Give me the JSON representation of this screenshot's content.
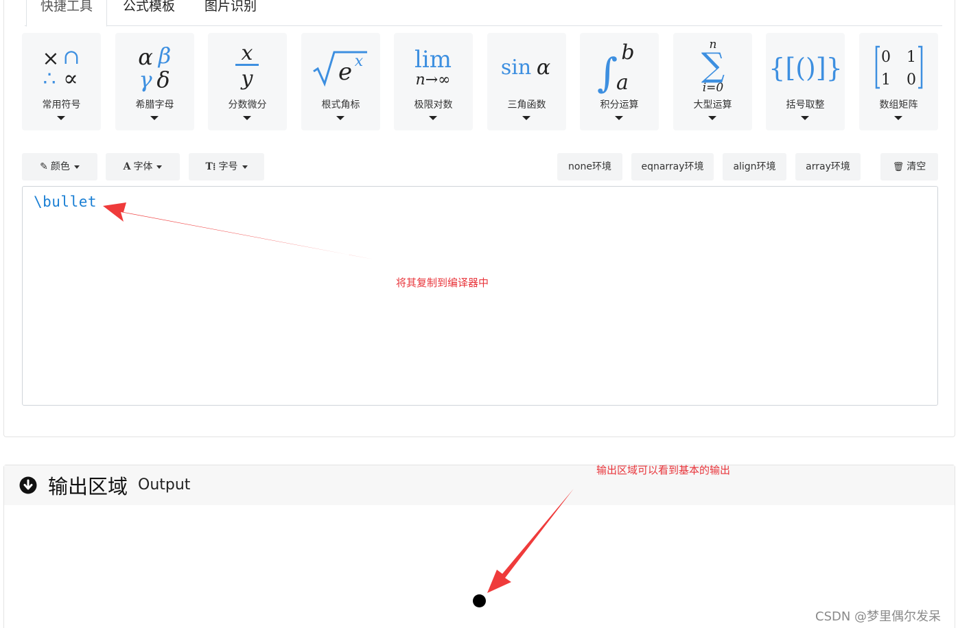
{
  "tabs": [
    {
      "label": "快捷工具",
      "active": true
    },
    {
      "label": "公式模板",
      "active": false
    },
    {
      "label": "图片识别",
      "active": false
    }
  ],
  "tools": [
    {
      "label": "常用符号"
    },
    {
      "label": "希腊字母"
    },
    {
      "label": "分数微分"
    },
    {
      "label": "根式角标"
    },
    {
      "label": "极限对数"
    },
    {
      "label": "三角函数"
    },
    {
      "label": "积分运算"
    },
    {
      "label": "大型运算"
    },
    {
      "label": "括号取整"
    },
    {
      "label": "数组矩阵"
    }
  ],
  "tool_glyphs": {
    "common": {
      "row1": [
        "×",
        "∩"
      ],
      "row2": [
        "∴",
        "∝"
      ]
    },
    "greek": {
      "row1": [
        "α",
        "β"
      ],
      "row2": [
        "γ",
        "δ"
      ]
    },
    "fraction": {
      "num": "x",
      "den": "y"
    },
    "root": {
      "base": "e",
      "exp": "x"
    },
    "limit": {
      "op": "lim",
      "sub": "n→∞"
    },
    "trig": {
      "fn": "sin",
      "arg": "α"
    },
    "integral": {
      "upper": "b",
      "lower": "a"
    },
    "sum": {
      "upper": "n",
      "lower": "i=0"
    },
    "brackets": {
      "text": "{[()]}"
    },
    "matrix": {
      "cells": [
        "0",
        "1",
        "1",
        "0"
      ]
    }
  },
  "format_buttons": {
    "color": "颜色",
    "font": "字体",
    "size": "字号",
    "size_icon": "T⁞"
  },
  "env_buttons": [
    "none环境",
    "eqnarray环境",
    "align环境",
    "array环境"
  ],
  "clear_button": "清空",
  "editor": {
    "code": "\\bullet"
  },
  "annotations": {
    "editor_note": "将其复制到编译器中",
    "output_note": "输出区域可以看到基本的输出"
  },
  "output": {
    "title": "输出区域",
    "subtitle": "Output"
  },
  "watermark": "CSDN @梦里偶尔发呆",
  "colors": {
    "accent_blue": "#3d8fe0",
    "code_blue": "#1a7fd4",
    "annotation_red": "#e8343a"
  }
}
